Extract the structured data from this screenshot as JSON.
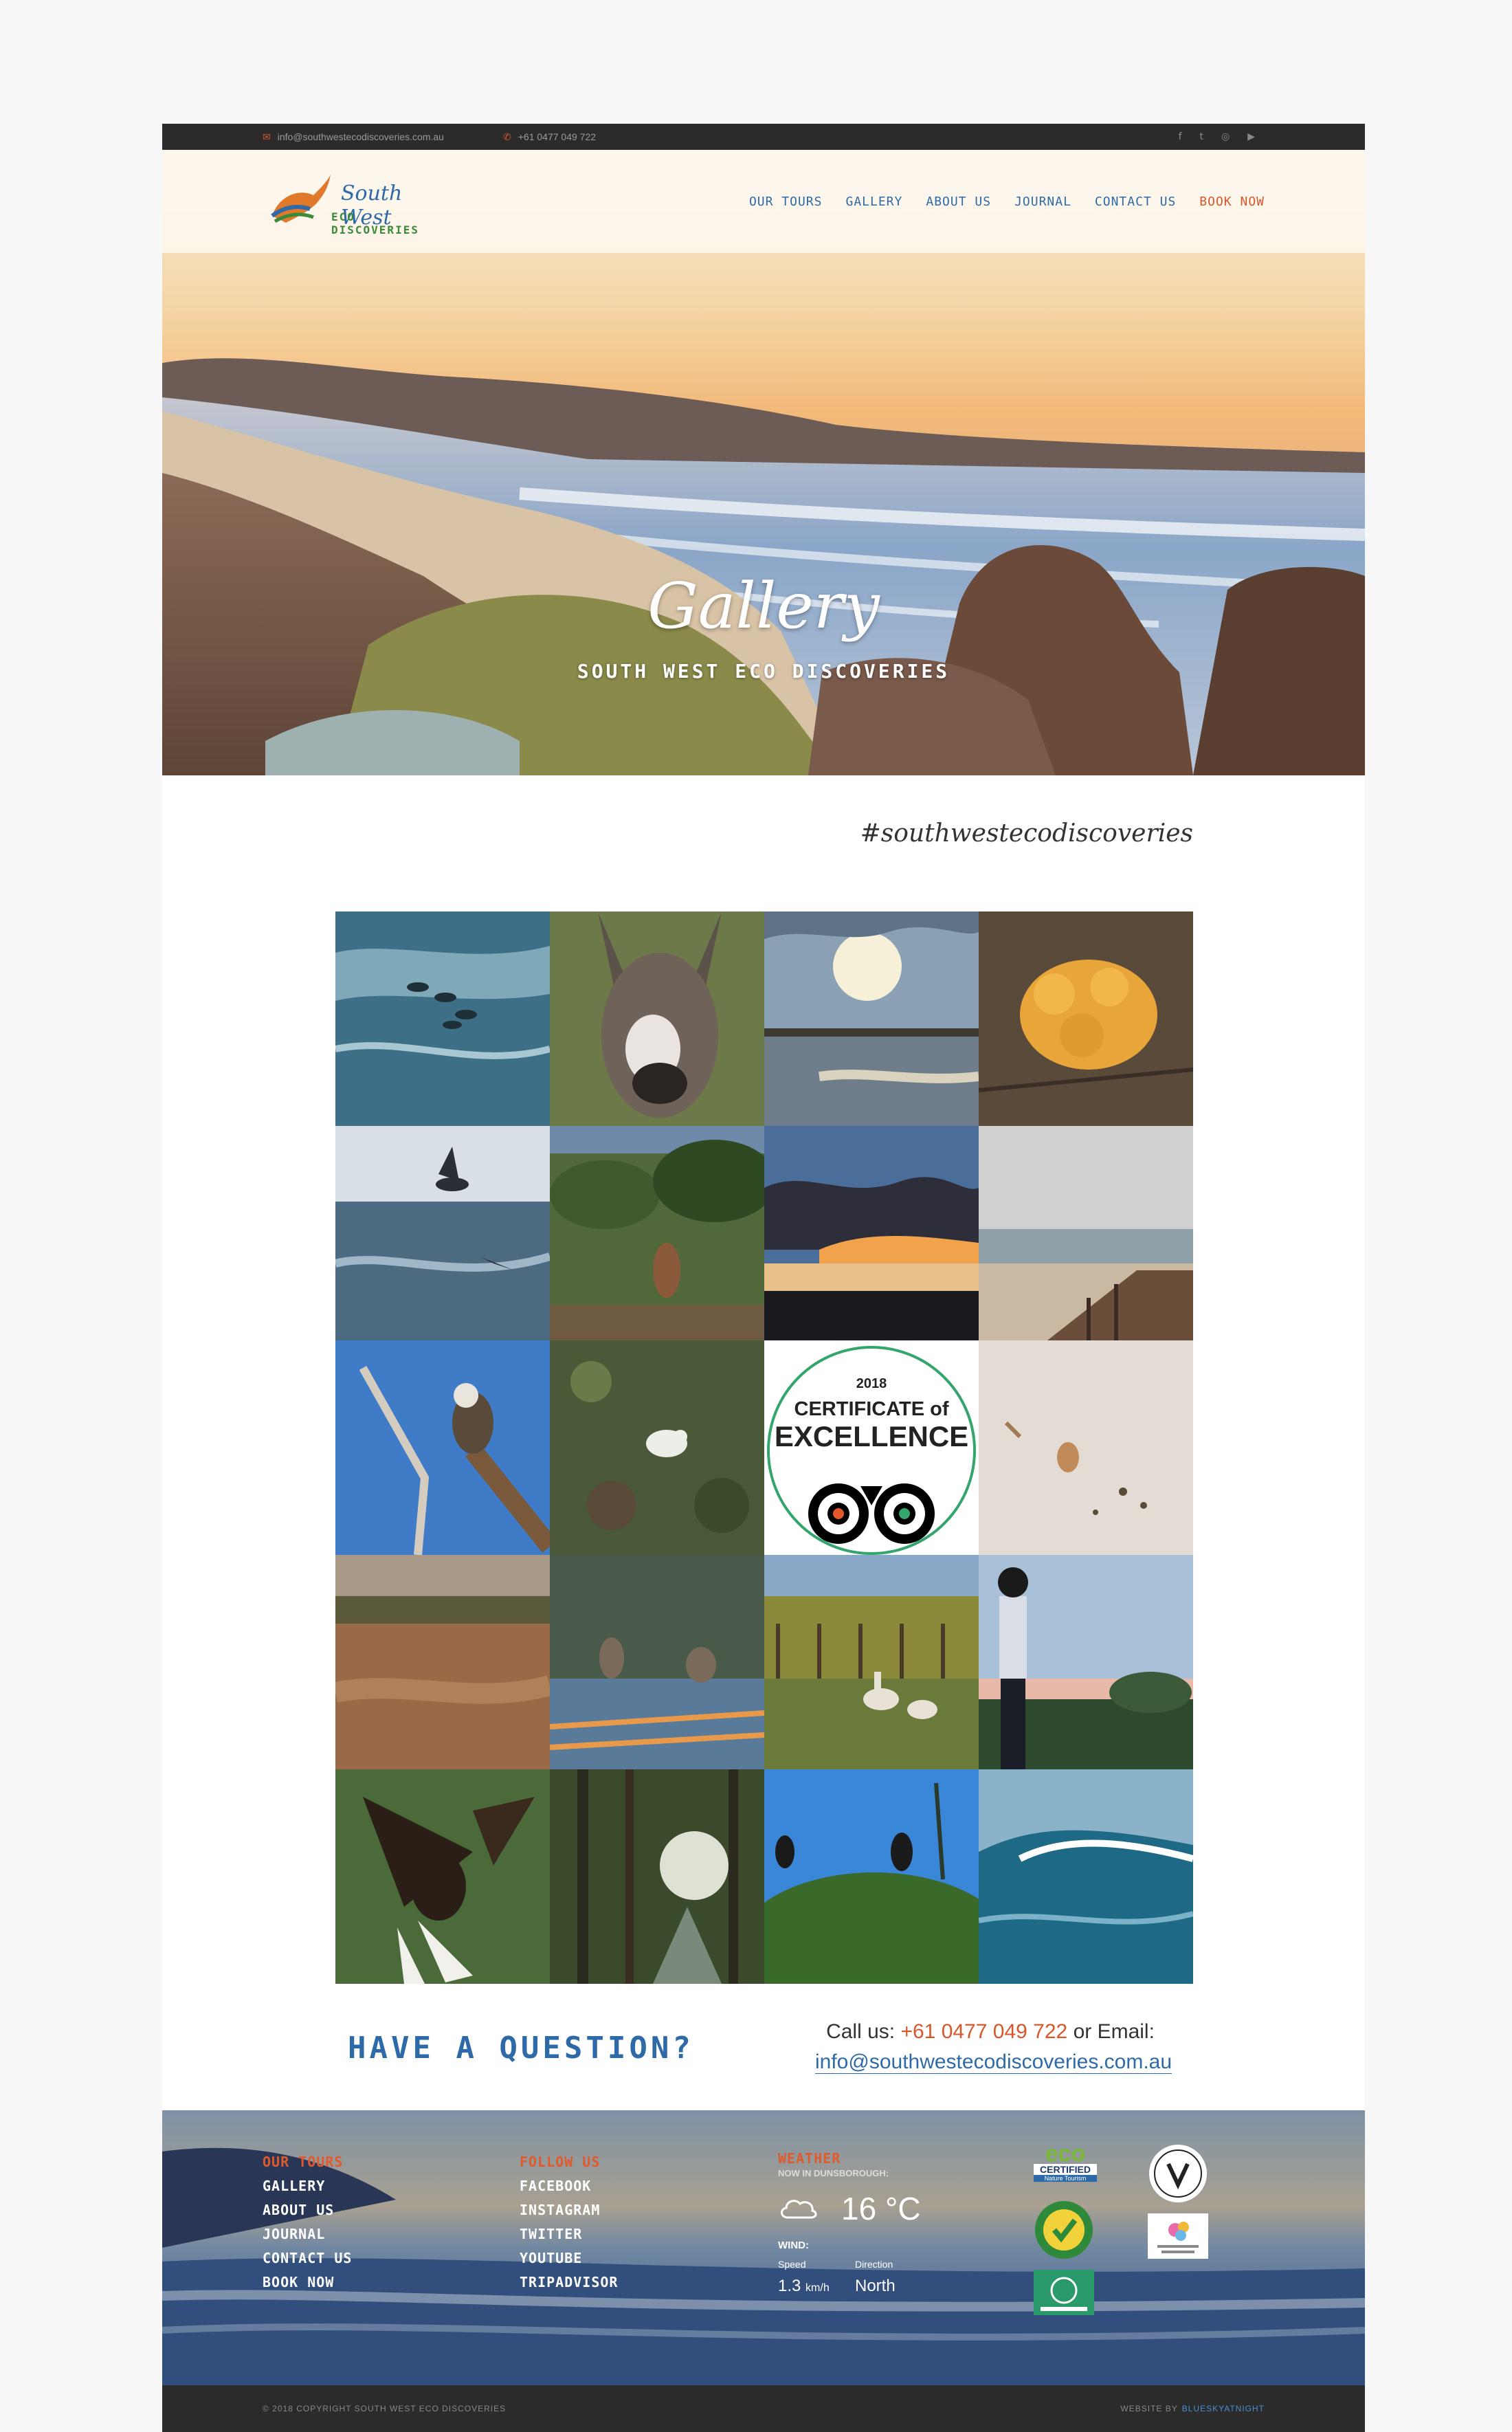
{
  "topbar": {
    "email": "info@southwestecodiscoveries.com.au",
    "phone": "+61 0477 049 722",
    "social_icons": [
      "facebook-icon",
      "twitter-icon",
      "instagram-icon",
      "youtube-icon"
    ]
  },
  "logo": {
    "line1": "South West",
    "line2": "ECO DISCOVERIES"
  },
  "nav": {
    "items": [
      "OUR TOURS",
      "GALLERY",
      "ABOUT US",
      "JOURNAL",
      "CONTACT US"
    ],
    "book": "BOOK NOW"
  },
  "hero": {
    "title": "Gallery",
    "subtitle": "SOUTH WEST ECO DISCOVERIES"
  },
  "hashtag": "#southwestecodiscoveries",
  "gallery": {
    "certificate": {
      "year": "2018",
      "line1": "CERTIFICATE of",
      "line2": "EXCELLENCE"
    }
  },
  "question": {
    "heading": "HAVE A QUESTION?",
    "call_prefix": "Call us:",
    "phone": "+61 0477 049 722",
    "email_prefix": "or Email:",
    "email": "info@southwestecodiscoveries.com.au"
  },
  "footer": {
    "col1": {
      "heading": "OUR TOURS",
      "items": [
        "GALLERY",
        "ABOUT US",
        "JOURNAL",
        "CONTACT US",
        "BOOK NOW"
      ]
    },
    "col2": {
      "heading": "FOLLOW US",
      "items": [
        "FACEBOOK",
        "INSTAGRAM",
        "TWITTER",
        "YOUTUBE",
        "TRIPADVISOR"
      ]
    },
    "weather": {
      "heading": "WEATHER",
      "now": "NOW IN DUNSBOROUGH:",
      "temp": "16 °C",
      "wind": "WIND:",
      "speed_label": "Speed",
      "direction_label": "Direction",
      "speed": "1.3",
      "speed_unit": "km/h",
      "direction": "North"
    },
    "badges": {
      "eco1": "eco",
      "eco2": "CERTIFIED",
      "eco3": "Nature Tourism"
    }
  },
  "bottombar": {
    "copyright": "© 2018 COPYRIGHT SOUTH WEST ECO DISCOVERIES",
    "credit_prefix": "WEBSITE BY",
    "credit_link": "BLUESKYATNIGHT"
  },
  "colors": {
    "accent_orange": "#d8572a",
    "brand_blue": "#2e6aa8",
    "dark_bar": "#2b2b2b"
  }
}
